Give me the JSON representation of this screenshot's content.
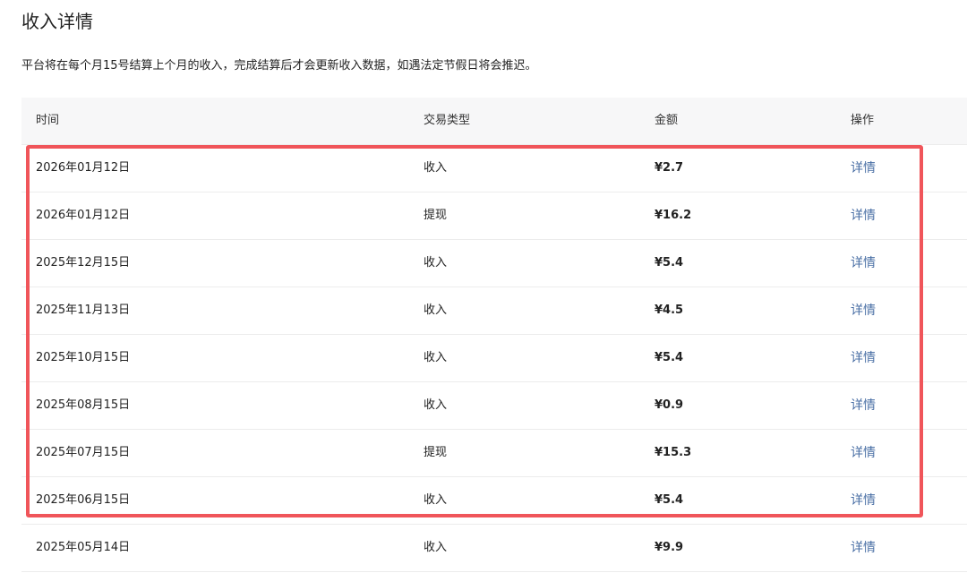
{
  "page": {
    "title": "收入详情",
    "notice": "平台将在每个月15号结算上个月的收入，完成结算后才会更新收入数据，如遇法定节假日将会推迟。"
  },
  "table": {
    "headers": {
      "time": "时间",
      "type": "交易类型",
      "amount": "金额",
      "action": "操作"
    },
    "rows": [
      {
        "time": "2026年01月12日",
        "type": "收入",
        "amount": "¥2.7",
        "action": "详情"
      },
      {
        "time": "2026年01月12日",
        "type": "提现",
        "amount": "¥16.2",
        "action": "详情"
      },
      {
        "time": "2025年12月15日",
        "type": "收入",
        "amount": "¥5.4",
        "action": "详情"
      },
      {
        "time": "2025年11月13日",
        "type": "收入",
        "amount": "¥4.5",
        "action": "详情"
      },
      {
        "time": "2025年10月15日",
        "type": "收入",
        "amount": "¥5.4",
        "action": "详情"
      },
      {
        "time": "2025年08月15日",
        "type": "收入",
        "amount": "¥0.9",
        "action": "详情"
      },
      {
        "time": "2025年07月15日",
        "type": "提现",
        "amount": "¥15.3",
        "action": "详情"
      },
      {
        "time": "2025年06月15日",
        "type": "收入",
        "amount": "¥5.4",
        "action": "详情"
      },
      {
        "time": "2025年05月14日",
        "type": "收入",
        "amount": "¥9.9",
        "action": "详情"
      }
    ]
  },
  "colors": {
    "highlight": "#f0555a",
    "link": "#4a6fa5",
    "header_bg": "#f7f7f8"
  }
}
